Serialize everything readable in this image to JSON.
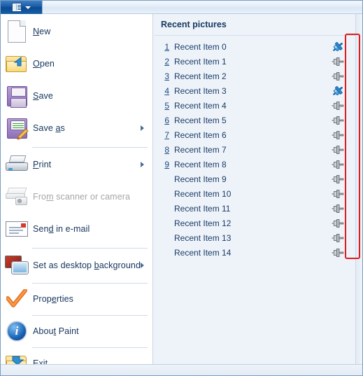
{
  "titlebar": {
    "app_button_name": "Paint application menu button",
    "icon": "menu-icon",
    "caret": "chevron-down-icon"
  },
  "left_menu": {
    "items": [
      {
        "label": "New",
        "accel": "N",
        "icon": "new-document-icon",
        "submenu": false,
        "disabled": false,
        "separator_after": false
      },
      {
        "label": "Open",
        "accel": "O",
        "icon": "open-folder-icon",
        "submenu": false,
        "disabled": false,
        "separator_after": false
      },
      {
        "label": "Save",
        "accel": "S",
        "icon": "floppy-disk-icon",
        "submenu": false,
        "disabled": false,
        "separator_after": false
      },
      {
        "label": "Save as",
        "accel": "a",
        "icon": "floppy-disk-pencil-icon",
        "submenu": true,
        "disabled": false,
        "separator_after": true
      },
      {
        "label": "Print",
        "accel": "P",
        "icon": "printer-icon",
        "submenu": true,
        "disabled": false,
        "separator_after": false
      },
      {
        "label": "From scanner or camera",
        "accel": "m",
        "icon": "scanner-camera-icon",
        "submenu": false,
        "disabled": true,
        "separator_after": false
      },
      {
        "label": "Send in e-mail",
        "accel": "d",
        "icon": "envelope-icon",
        "submenu": false,
        "disabled": false,
        "separator_after": true
      },
      {
        "label": "Set as desktop background",
        "accel": "b",
        "icon": "desktop-monitor-icon",
        "submenu": true,
        "disabled": false,
        "separator_after": true
      },
      {
        "label": "Properties",
        "accel": "e",
        "icon": "orange-check-icon",
        "submenu": false,
        "disabled": false,
        "separator_after": true
      },
      {
        "label": "About Paint",
        "accel": "t",
        "icon": "info-circle-icon",
        "submenu": false,
        "disabled": false,
        "separator_after": true
      },
      {
        "label": "Exit",
        "accel": "x",
        "icon": "exit-folder-icon",
        "submenu": false,
        "disabled": false,
        "separator_after": false
      }
    ]
  },
  "right_pane": {
    "title": "Recent pictures",
    "items": [
      {
        "number": "1",
        "label": "Recent Item 0",
        "pinned": true,
        "pin_icon": "pin-pinned-icon"
      },
      {
        "number": "2",
        "label": "Recent Item 1",
        "pinned": false,
        "pin_icon": "pin-unpinned-icon"
      },
      {
        "number": "3",
        "label": "Recent Item 2",
        "pinned": false,
        "pin_icon": "pin-unpinned-icon"
      },
      {
        "number": "4",
        "label": "Recent Item 3",
        "pinned": true,
        "pin_icon": "pin-pinned-icon"
      },
      {
        "number": "5",
        "label": "Recent Item 4",
        "pinned": false,
        "pin_icon": "pin-unpinned-icon"
      },
      {
        "number": "6",
        "label": "Recent Item 5",
        "pinned": false,
        "pin_icon": "pin-unpinned-icon"
      },
      {
        "number": "7",
        "label": "Recent Item 6",
        "pinned": false,
        "pin_icon": "pin-unpinned-icon"
      },
      {
        "number": "8",
        "label": "Recent Item 7",
        "pinned": false,
        "pin_icon": "pin-unpinned-icon"
      },
      {
        "number": "9",
        "label": "Recent Item 8",
        "pinned": false,
        "pin_icon": "pin-unpinned-icon"
      },
      {
        "number": "",
        "label": "Recent Item 9",
        "pinned": false,
        "pin_icon": "pin-unpinned-icon"
      },
      {
        "number": "",
        "label": "Recent Item 10",
        "pinned": false,
        "pin_icon": "pin-unpinned-icon"
      },
      {
        "number": "",
        "label": "Recent Item 11",
        "pinned": false,
        "pin_icon": "pin-unpinned-icon"
      },
      {
        "number": "",
        "label": "Recent Item 12",
        "pinned": false,
        "pin_icon": "pin-unpinned-icon"
      },
      {
        "number": "",
        "label": "Recent Item 13",
        "pinned": false,
        "pin_icon": "pin-unpinned-icon"
      },
      {
        "number": "",
        "label": "Recent Item 14",
        "pinned": false,
        "pin_icon": "pin-unpinned-icon"
      }
    ]
  },
  "annotation": {
    "name": "pin-column-highlight",
    "color": "#e01b1b"
  },
  "colors": {
    "titlebar_button": "#1b5ea6",
    "left_pane_bg": "#ffffff",
    "right_pane_bg": "#eef3fa",
    "text": "#15355c",
    "disabled_text": "#a6a6a6",
    "highlight": "#e01b1b"
  }
}
